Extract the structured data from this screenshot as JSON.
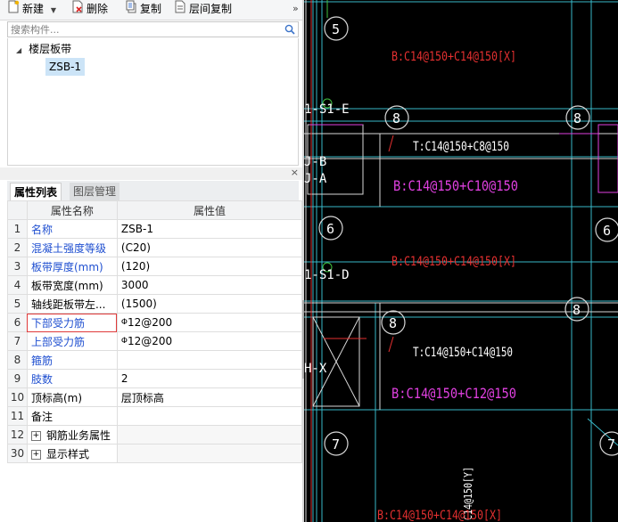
{
  "toolbar": {
    "new_label": "新建",
    "delete_label": "删除",
    "copy_label": "复制",
    "floor_copy_label": "层间复制",
    "more_symbol": "»"
  },
  "search": {
    "placeholder": "搜索构件..."
  },
  "tree": {
    "root_label": "楼层板带",
    "child_label": "ZSB-1"
  },
  "panel": {
    "close_symbol": "×"
  },
  "tabs": {
    "properties_label": "属性列表",
    "layers_label": "图层管理"
  },
  "grid": {
    "header_name": "属性名称",
    "header_value": "属性值",
    "rows": [
      {
        "num": "1",
        "name": "名称",
        "value": "ZSB-1"
      },
      {
        "num": "2",
        "name": "混凝土强度等级",
        "value": "(C20)"
      },
      {
        "num": "3",
        "name": "板带厚度(mm)",
        "value": "(120)"
      },
      {
        "num": "4",
        "name": "板带宽度(mm)",
        "value": "3000"
      },
      {
        "num": "5",
        "name": "轴线距板带左...",
        "value": "(1500)"
      },
      {
        "num": "6",
        "name": "下部受力筋",
        "value": "12@200",
        "rebar": "Φ"
      },
      {
        "num": "7",
        "name": "上部受力筋",
        "value": "12@200",
        "rebar": "Φ"
      },
      {
        "num": "8",
        "name": "箍筋",
        "value": ""
      },
      {
        "num": "9",
        "name": "肢数",
        "value": "2"
      },
      {
        "num": "10",
        "name": "顶标高(m)",
        "value": "层顶标高"
      },
      {
        "num": "11",
        "name": "备注",
        "value": ""
      },
      {
        "num": "12",
        "name": "钢筋业务属性",
        "value": ""
      },
      {
        "num": "30",
        "name": "显示样式",
        "value": ""
      }
    ]
  },
  "cad": {
    "texts": {
      "b1": "B:C14@150+C14@150[X]",
      "s1e": "1-S1-E",
      "t1": "T:C14@150+C8@150",
      "jb": "J-B",
      "ja": "J-A",
      "b2": "B:C14@150+C10@150",
      "b3": "B:C14@150+C14@150[X]",
      "s1d": "1-S1-D",
      "t2": "T:C14@150+C14@150",
      "hx": "H-X",
      "b4": "B:C14@150+C12@150",
      "vert": "C14@150[Y]",
      "b5": "B:C14@150+C14@150[X]",
      "num5a": "5",
      "num8a": "8",
      "num8b": "8",
      "num6a": "6",
      "num6b": "6",
      "num8c": "8",
      "num8d": "8",
      "num8e": "8",
      "num7a": "7",
      "num7b": "7"
    },
    "colors": {
      "background": "#000000",
      "grid_line": "#38b9c9",
      "beam_line": "#d8d8d8",
      "red_text": "#e53030",
      "magenta": "#e040e0",
      "white_text": "#ffffff",
      "green": "#3fc23f"
    }
  }
}
